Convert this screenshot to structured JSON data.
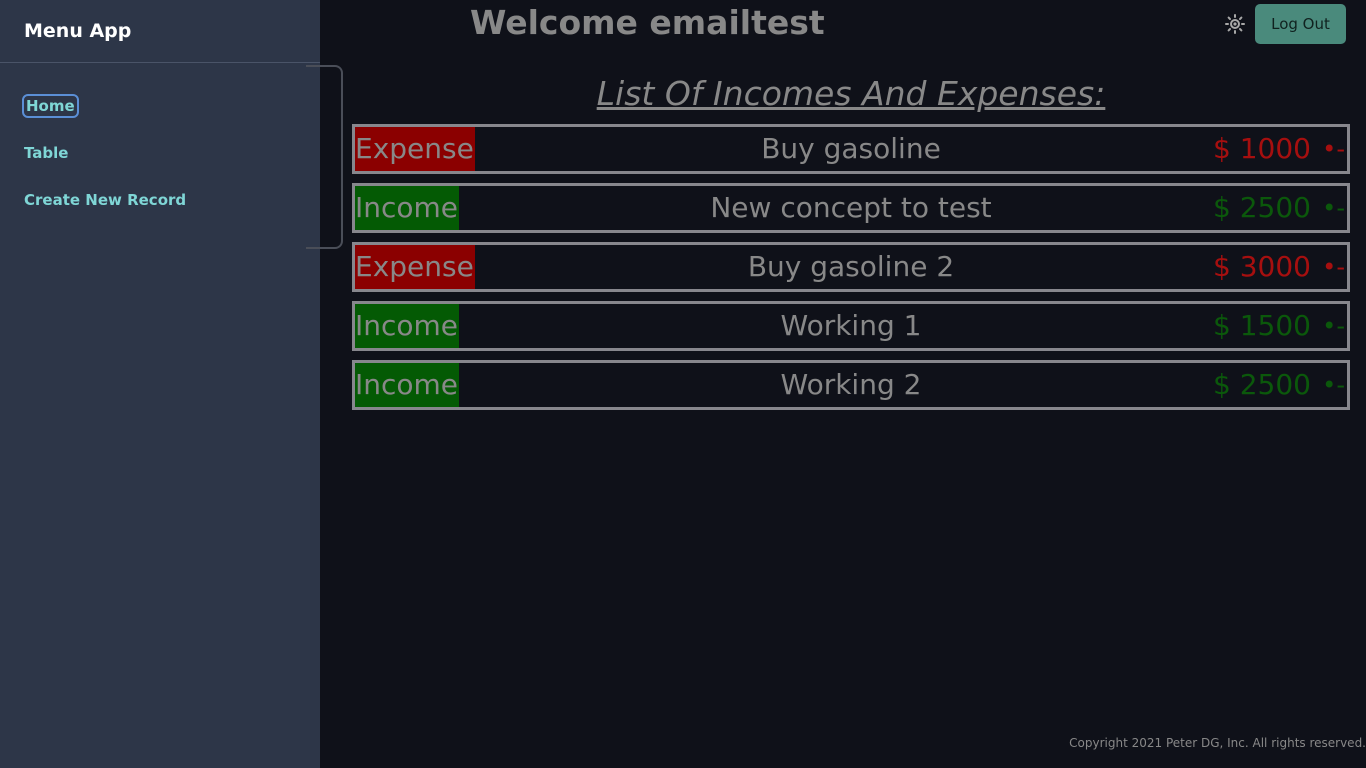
{
  "sidebar": {
    "title": "Menu App",
    "items": [
      {
        "label": "Home",
        "active": true
      },
      {
        "label": "Table"
      },
      {
        "label": "Create New Record"
      }
    ]
  },
  "header": {
    "welcome": "Welcome emailtest",
    "theme_icon": "sun-icon",
    "logout_label": "Log Out"
  },
  "main": {
    "heading": "List Of Incomes And Expenses:",
    "records": [
      {
        "type": "Expense",
        "concept": "Buy gasoline",
        "amount": "$ 1000",
        "action": "•-"
      },
      {
        "type": "Income",
        "concept": "New concept to test",
        "amount": "$ 2500",
        "action": "•-"
      },
      {
        "type": "Expense",
        "concept": "Buy gasoline 2",
        "amount": "$ 3000",
        "action": "•-"
      },
      {
        "type": "Income",
        "concept": "Working 1",
        "amount": "$ 1500",
        "action": "•-"
      },
      {
        "type": "Income",
        "concept": "Working 2",
        "amount": "$ 2500",
        "action": "•-"
      }
    ]
  },
  "footer": {
    "copyright": "Copyright 2021 Peter DG, Inc. All rights reserved."
  },
  "colors": {
    "sidebar_bg": "#2d3648",
    "page_bg": "#0f1119",
    "expense": "#8b0000",
    "income": "#045a04",
    "accent": "#4a8a7c",
    "nav_link": "#7fd6d6"
  }
}
